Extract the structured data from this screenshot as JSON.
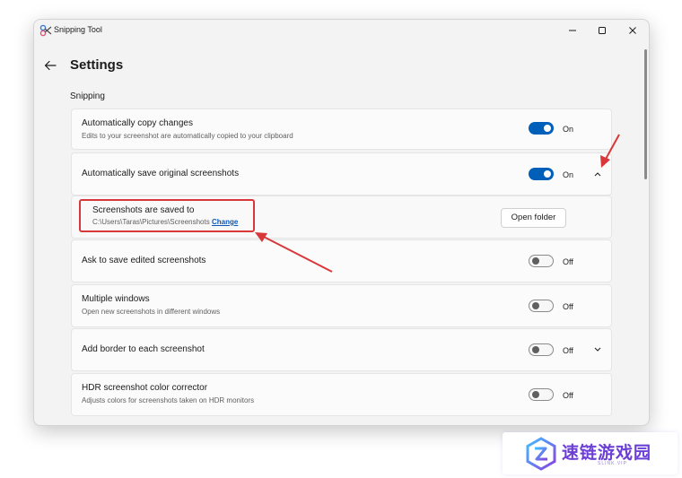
{
  "window": {
    "title": "Snipping Tool",
    "controls": [
      "minimize",
      "maximize",
      "close"
    ]
  },
  "header": {
    "page_title": "Settings"
  },
  "section": {
    "title": "Snipping"
  },
  "settings": [
    {
      "title": "Automatically copy changes",
      "description": "Edits to your screenshot are automatically copied to your clipboard",
      "state": "On",
      "toggle_on": true
    },
    {
      "title": "Automatically save original screenshots",
      "state": "On",
      "toggle_on": true,
      "expanded": true
    },
    {
      "title": "Screenshots are saved to",
      "path": "C:\\Users\\Taras\\Pictures\\Screenshots",
      "link": "Change",
      "button": "Open folder"
    },
    {
      "title": "Ask to save edited screenshots",
      "state": "Off",
      "toggle_on": false
    },
    {
      "title": "Multiple windows",
      "description": "Open new screenshots in different windows",
      "state": "Off",
      "toggle_on": false
    },
    {
      "title": "Add border to each screenshot",
      "state": "Off",
      "toggle_on": false,
      "expanded": false
    },
    {
      "title": "HDR screenshot color corrector",
      "description": "Adjusts colors for screenshots taken on HDR monitors",
      "state": "Off",
      "toggle_on": false
    }
  ],
  "icons": {
    "app": "snipping-tool-icon",
    "back": "back-arrow-icon",
    "chevron_up": "chevron-up-icon",
    "chevron_down": "chevron-down-icon"
  },
  "colors": {
    "accent": "#005fb8",
    "annotation": "#d9383a",
    "link": "#0a58b8"
  },
  "watermark": {
    "text": "速链游戏园",
    "sub": "SLINK.VIP"
  }
}
